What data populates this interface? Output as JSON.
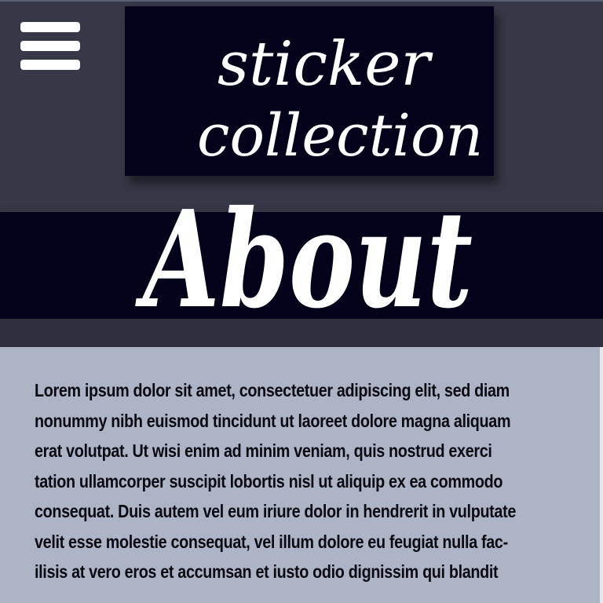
{
  "header": {
    "logo_line1": "sticker",
    "logo_line2": "collection",
    "menu_icon": "hamburger-menu-icon"
  },
  "hero": {
    "title": "About"
  },
  "content": {
    "lines": [
      "Lorem ipsum dolor sit amet, consectetuer adipiscing elit, sed diam",
      "nonummy nibh euismod tincidunt ut laoreet dolore magna aliquam",
      "erat volutpat. Ut wisi enim ad minim veniam, quis nostrud exerci",
      "tation ullamcorper suscipit lobortis nisl ut aliquip ex ea commodo",
      "consequat. Duis autem vel eum iriure dolor in hendrerit in vulputate",
      "velit esse molestie consequat, vel illum dolore eu feugiat nulla fac-",
      "ilisis at vero eros et accumsan et iusto odio dignissim qui blandit"
    ]
  },
  "colors": {
    "header_bg": "#363847",
    "logo_bg": "#02031a",
    "band_bg": "#02031a",
    "content_bg": "#adb4c6",
    "text": "#0a0a12"
  }
}
